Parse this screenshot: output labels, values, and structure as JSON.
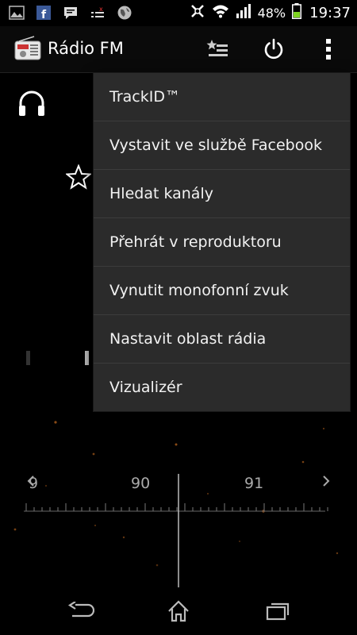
{
  "status_bar": {
    "battery_percent": "48%",
    "time": "19:37",
    "notification_icons": [
      "gallery-icon",
      "facebook-icon",
      "message-icon",
      "tasks-icon",
      "globe-icon"
    ]
  },
  "action_bar": {
    "app_title": "Rádio FM"
  },
  "tuner": {
    "left_label": "9",
    "frequency_label_1": "90",
    "frequency_label_2": "91"
  },
  "menu": {
    "items": [
      "TrackID™",
      "Vystavit ve službě Facebook",
      "Hledat kanály",
      "Přehrát v reproduktoru",
      "Vynutit monofonní zvuk",
      "Nastavit oblast rádia",
      "Vizualizér"
    ]
  },
  "colors": {
    "background": "#000000",
    "menu_background": "#2b2b2b",
    "menu_divider": "#3c3c3c",
    "battery_green": "#7ed321",
    "text": "#ffffff"
  }
}
